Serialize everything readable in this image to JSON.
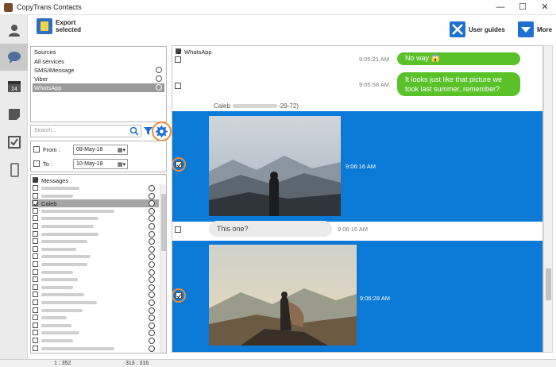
{
  "window": {
    "title": "CopyTrans Contacts"
  },
  "toolbar": {
    "export_line1": "Export",
    "export_line2": "selected",
    "user_guides": "User guides",
    "more": "More"
  },
  "sources": {
    "header": "Sources",
    "items": [
      {
        "label": "All services"
      },
      {
        "label": "SMS/iMessage"
      },
      {
        "label": "Viber"
      },
      {
        "label": "WhatsApp"
      }
    ]
  },
  "search": {
    "placeholder": "Search..."
  },
  "dates": {
    "from_label": "From :",
    "from_value": "09-May-18",
    "to_label": "To :",
    "to_value": "10-May-18"
  },
  "messages": {
    "header": "Messages",
    "selected_name": "Caleb"
  },
  "chat": {
    "header": "WhatsApp",
    "msg1_text": "No way 😱",
    "msg1_time": "9:05:21 AM",
    "msg2_line1": "It looks just like that picture we",
    "msg2_line2": "took last summer, remember?",
    "msg2_time": "9:05:58 AM",
    "sender_name": "Caleb",
    "sender_suffix": "-29-72)",
    "img1_time": "9:06:16 AM",
    "msg3_text": "This one?",
    "msg3_time": "9:06:16 AM",
    "img2_time": "9:06:28 AM"
  },
  "status": {
    "left": "1 : 352",
    "right": "313 : 316"
  },
  "colors": {
    "accent_blue": "#0b79d6",
    "bubble_green": "#5ac129",
    "highlight_orange": "#f08d3a"
  }
}
